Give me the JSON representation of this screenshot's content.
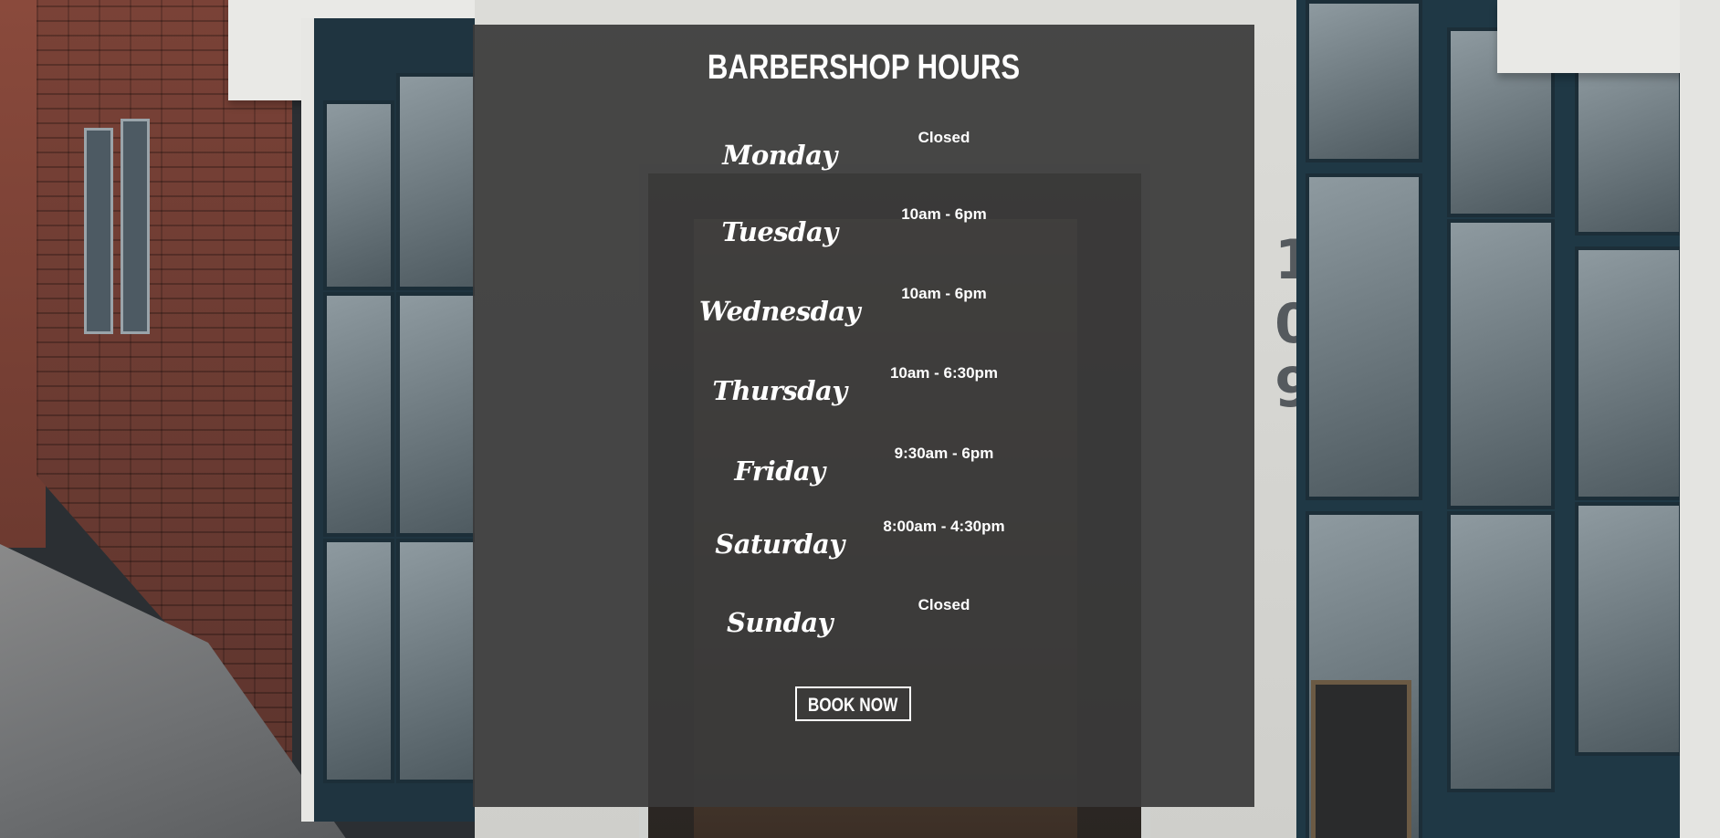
{
  "hours": {
    "title": "BARBERSHOP HOURS",
    "days": [
      {
        "day": "Monday",
        "time": "Closed"
      },
      {
        "day": "Tuesday",
        "time": "10am - 6pm"
      },
      {
        "day": "Wednesday",
        "time": "10am - 6pm"
      },
      {
        "day": "Thursday",
        "time": "10am - 6:30pm"
      },
      {
        "day": "Friday",
        "time": "9:30am - 6pm"
      },
      {
        "day": "Saturday",
        "time": "8:00am - 4:30pm"
      },
      {
        "day": "Sunday",
        "time": "Closed"
      }
    ],
    "book_label": "BOOK NOW"
  },
  "background": {
    "street_number": "109"
  },
  "colors": {
    "panel_overlay": "#3a3a3a",
    "text": "#ffffff"
  }
}
